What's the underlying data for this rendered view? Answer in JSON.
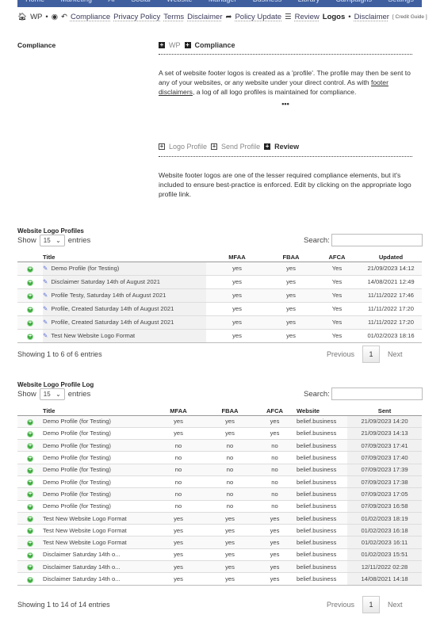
{
  "topnav": [
    "Home",
    "Marketing",
    "AI",
    "Social",
    "Website",
    "Manager",
    "Business",
    "Library",
    "Campaigns",
    "Settings"
  ],
  "breadcrumb": {
    "wp": "WP",
    "sep": "•",
    "items": [
      "Compliance",
      "Privacy Policy",
      "Terms",
      "Disclaimer"
    ],
    "policy_update": "Policy Update",
    "review": "Review",
    "current": "Logos",
    "sep2": "•",
    "disclaimer": "Disclaimer",
    "credit": "[ Credit Guide ]"
  },
  "left_heading": "Compliance",
  "top_tabs": {
    "wp": "WP",
    "compliance": "Compliance"
  },
  "intro": {
    "before": "A set of website footer logos is created as a 'profile'. The profile may then be sent to any of your websites, or any website under your direct control. As with ",
    "link": "footer disclaimers",
    "after": ", a log of all logo profiles is maintained for compliance."
  },
  "ellipsis": "•••",
  "sub_tabs": {
    "logo_profile": "Logo Profile",
    "send_profile": "Send Profile",
    "review": "Review"
  },
  "review_text": "Website footer logos are one of the lesser required compliance elements, but it's included to ensure best-practice is enforced. Edit by clicking on the appropriate logo profile link.",
  "profiles": {
    "title": "Website Logo Profiles",
    "show": "Show",
    "entries": "entries",
    "page_size": "15",
    "search": "Search:",
    "columns": [
      "Title",
      "MFAA",
      "FBAA",
      "AFCA",
      "Updated"
    ],
    "rows": [
      [
        "Demo Profile (for Testing)",
        "yes",
        "yes",
        "Yes",
        "21/09/2023 14:12"
      ],
      [
        "Disclaimer Saturday 14th of August 2021",
        "yes",
        "yes",
        "Yes",
        "14/08/2021 12:49"
      ],
      [
        "Profile Testy, Saturday 14th of August 2021",
        "yes",
        "yes",
        "Yes",
        "11/11/2022 17:46"
      ],
      [
        "Profile, Created Saturday 14th of August 2021",
        "yes",
        "yes",
        "Yes",
        "11/11/2022 17:20"
      ],
      [
        "Profile, Created Saturday 14th of August 2021",
        "yes",
        "yes",
        "Yes",
        "11/11/2022 17:20"
      ],
      [
        "Test New Website Logo Format",
        "yes",
        "yes",
        "Yes",
        "01/02/2023 18:16"
      ]
    ],
    "info": "Showing 1 to 6 of 6 entries",
    "previous": "Previous",
    "page": "1",
    "next": "Next"
  },
  "log": {
    "title": "Website Logo Profile Log",
    "show": "Show",
    "entries": "entries",
    "page_size": "15",
    "search": "Search:",
    "columns": [
      "Title",
      "MFAA",
      "FBAA",
      "AFCA",
      "Website",
      "Sent"
    ],
    "rows": [
      [
        "Demo Profile (for Testing)",
        "yes",
        "yes",
        "yes",
        "belief.business",
        "21/09/2023 14:20"
      ],
      [
        "Demo Profile (for Testing)",
        "yes",
        "yes",
        "yes",
        "belief.business",
        "21/09/2023 14:13"
      ],
      [
        "Demo Profile (for Testing)",
        "no",
        "no",
        "no",
        "belief.business",
        "07/09/2023 17:41"
      ],
      [
        "Demo Profile (for Testing)",
        "no",
        "no",
        "no",
        "belief.business",
        "07/09/2023 17:40"
      ],
      [
        "Demo Profile (for Testing)",
        "no",
        "no",
        "no",
        "belief.business",
        "07/09/2023 17:39"
      ],
      [
        "Demo Profile (for Testing)",
        "no",
        "no",
        "no",
        "belief.business",
        "07/09/2023 17:38"
      ],
      [
        "Demo Profile (for Testing)",
        "no",
        "no",
        "no",
        "belief.business",
        "07/09/2023 17:05"
      ],
      [
        "Demo Profile (for Testing)",
        "no",
        "no",
        "no",
        "belief.business",
        "07/09/2023 16:58"
      ],
      [
        "Test New Website Logo Format",
        "yes",
        "yes",
        "yes",
        "belief.business",
        "01/02/2023 18:19"
      ],
      [
        "Test New Website Logo Format",
        "yes",
        "yes",
        "yes",
        "belief.business",
        "01/02/2023 16:18"
      ],
      [
        "Test New Website Logo Format",
        "yes",
        "yes",
        "yes",
        "belief.business",
        "01/02/2023 16:11"
      ],
      [
        "Disclaimer Saturday 14th o...",
        "yes",
        "yes",
        "yes",
        "belief.business",
        "01/02/2023 15:51"
      ],
      [
        "Disclaimer Saturday 14th o...",
        "yes",
        "yes",
        "yes",
        "belief.business",
        "12/11/2022 02:28"
      ],
      [
        "Disclaimer Saturday 14th o...",
        "yes",
        "yes",
        "yes",
        "belief.business",
        "14/08/2021 14:18"
      ]
    ],
    "info": "Showing 1 to 14 of 14 entries",
    "previous": "Previous",
    "page": "1",
    "next": "Next"
  },
  "colors": {
    "nav": "#3f5f9f",
    "add": "#3aa83a",
    "edit": "#5d6fd6"
  }
}
